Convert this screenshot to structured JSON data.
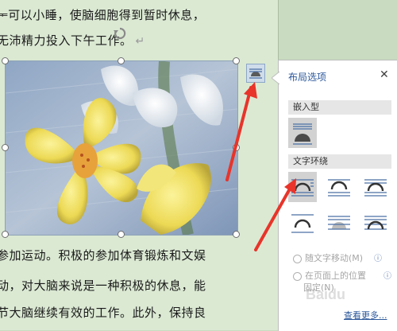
{
  "document": {
    "lines": [
      "ᆍ可以小睡，使脑细胞得到暂时休息，",
      "无沛精力投入下午工作。",
      "参加运动。积极的参加体育锻炼和文娱",
      "动，对大脑来说是一种积极的休息，能",
      "节大脑继续有效的工作。此外，保持良"
    ],
    "paragraph_mark": "↵"
  },
  "layout_panel": {
    "title": "布局选项",
    "close_icon": "close-icon",
    "inline_section": "嵌入型",
    "wrap_section": "文字环绕",
    "move_with_text": "随文字移动(M)",
    "fix_on_page_line1": "在页面上的位置",
    "fix_on_page_line2": "固定(N)",
    "see_more": "查看更多..."
  },
  "colors": {
    "accent": "#2b579a",
    "arrow": "#e8342a",
    "page_bg": "#dbe9d3"
  },
  "watermark": "Baidu"
}
